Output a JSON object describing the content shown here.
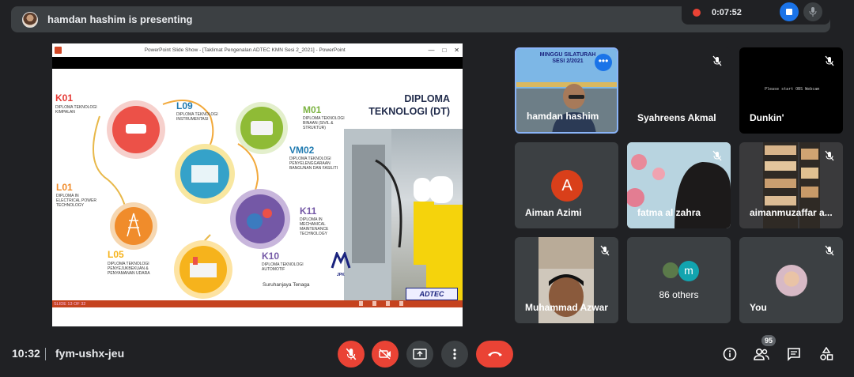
{
  "banner": {
    "presenting_text": "hamdan hashim is presenting"
  },
  "recording": {
    "time": "0:07:52"
  },
  "slide_window": {
    "title": "PowerPoint Slide Show - [Taklimat Pengenalan ADTEC KMN Sesi 2_2021] - PowerPoint",
    "status_text": "SLIDE 13 OF 32",
    "heading_line1": "DIPLOMA",
    "heading_line2": "TEKNOLOGI (DT)",
    "courses": [
      {
        "code": "K01",
        "desc": "DIPLOMA TEKNOLOGI KIMPALAN"
      },
      {
        "code": "L09",
        "desc": "DIPLOMA TEKNOLOGI INSTRUMENTASI"
      },
      {
        "code": "M01",
        "desc": "DIPLOMA TEKNOLOGI BINAAN (SIVIL & STRUKTUR)"
      },
      {
        "code": "VM02",
        "desc": "DIPLOMA TEKNOLOGI PENYELENGGARAAN BANGUNAN DAN FASILITI"
      },
      {
        "code": "L01",
        "desc": "DIPLOMA IN ELECTRICAL POWER TECHNOLOGY"
      },
      {
        "code": "K11",
        "desc": "DIPLOMA IN MECHANICAL MAINTENANCE TECHNOLOGY"
      },
      {
        "code": "L05",
        "desc": "DIPLOMA TEKNOLOGI PENYEJUKBEKUAN & PENYAMANAN UDARA"
      },
      {
        "code": "K10",
        "desc": "DIPLOMA TEKNOLOGI AUTOMOTIF"
      }
    ],
    "logo_suruhanjaya": "Suruhanjaya Tenaga",
    "logo_jpk": "JPK",
    "logo_adtec": "ADTEC",
    "logo_adtec_sub": "KEMAMAN",
    "banner_line1": "MINGGU SILATURAH",
    "banner_line2": "SESI 2/2021"
  },
  "participants": [
    {
      "name": "hamdan hashim"
    },
    {
      "name": "Syahreens Akmal"
    },
    {
      "name": "Dunkin'",
      "screen_text": "Please start OBS Webcam"
    },
    {
      "name": "Aiman Azimi",
      "initial": "A"
    },
    {
      "name": "fatma al zahra"
    },
    {
      "name": "aimanmuzaffar a..."
    },
    {
      "name": "Muhammad Azwar"
    },
    {
      "name": "86 others",
      "chip_initial": "m"
    },
    {
      "name": "You"
    }
  ],
  "bottom": {
    "clock": "10:32",
    "meeting_code": "fym-ushx-jeu",
    "people_count": "95"
  },
  "colors": {
    "danger": "#ea4335",
    "accent": "#1a73e8",
    "surface": "#3c4043",
    "background": "#202124"
  }
}
